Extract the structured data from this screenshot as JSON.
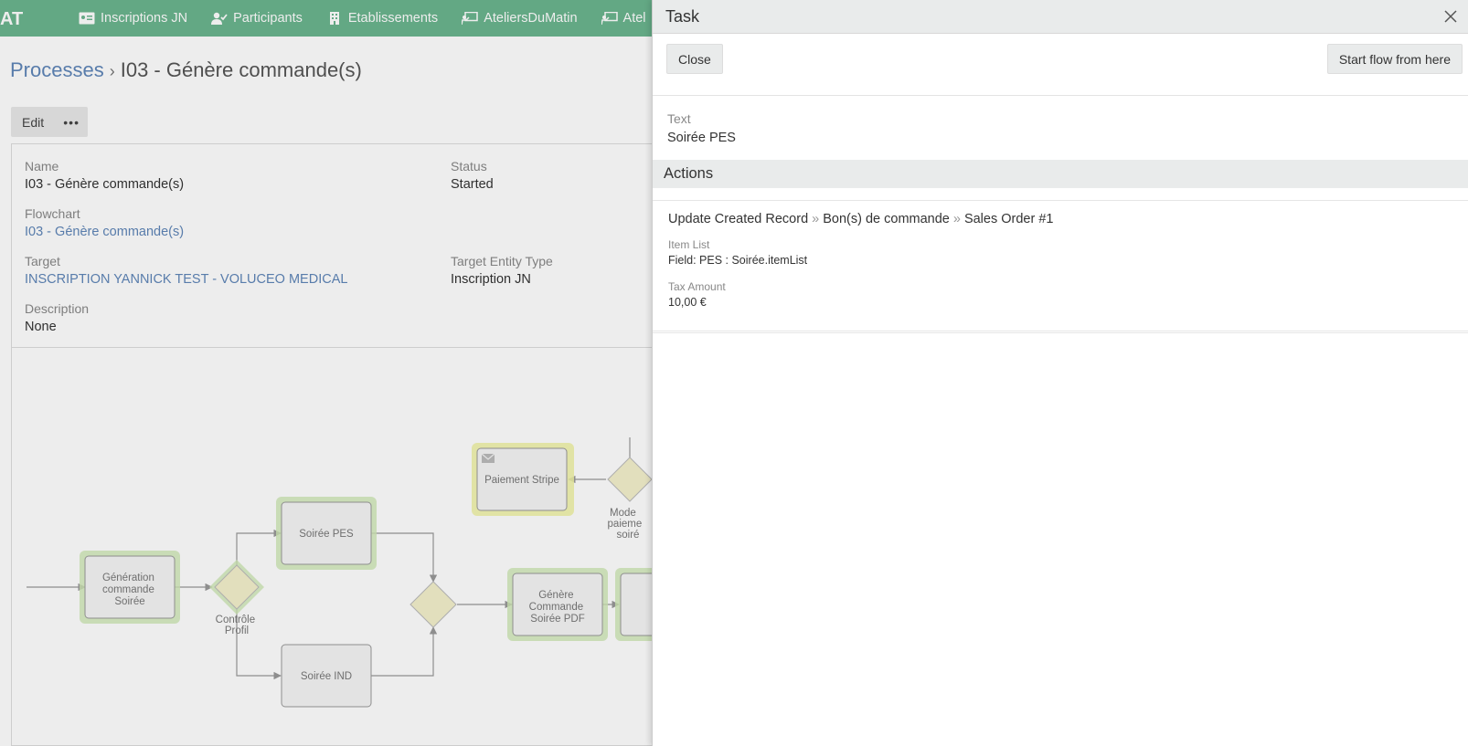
{
  "navbar": {
    "brand": "AT",
    "items": [
      {
        "label": "Inscriptions JN",
        "icon": "id-card-icon"
      },
      {
        "label": "Participants",
        "icon": "user-check-icon"
      },
      {
        "label": "Etablissements",
        "icon": "building-icon"
      },
      {
        "label": "AteliersDuMatin",
        "icon": "presentation-icon"
      },
      {
        "label": "Atel",
        "icon": "presentation-icon"
      }
    ]
  },
  "breadcrumb": {
    "parent": "Processes",
    "separator": "›",
    "current": "I03 - Génère commande(s)"
  },
  "toolbar": {
    "edit_label": "Edit",
    "more_label": "•••"
  },
  "record": {
    "name_label": "Name",
    "name_value": "I03 - Génère commande(s)",
    "status_label": "Status",
    "status_value": "Started",
    "flowchart_label": "Flowchart",
    "flowchart_value": "I03 - Génère commande(s)",
    "target_label": "Target",
    "target_value": "INSCRIPTION YANNICK TEST - VOLUCEO MEDICAL",
    "target_entity_label": "Target Entity Type",
    "target_entity_value": "Inscription JN",
    "description_label": "Description",
    "description_value": "None"
  },
  "flowchart": {
    "nodes": {
      "generation": [
        "Génération",
        "commande",
        "Soirée"
      ],
      "controle": [
        "Contrôle",
        "Profil"
      ],
      "soiree_pes": "Soirée PES",
      "soiree_ind": "Soirée IND",
      "paiement": "Paiement Stripe",
      "mode": [
        "Mode",
        "paieme",
        "soiré"
      ],
      "genere_pdf": [
        "Génère",
        "Commande",
        "Soirée PDF"
      ]
    },
    "colors": {
      "task_fill": "#f5f5f5",
      "task_stroke": "#999999",
      "gateway_fill": "#f4f0cc",
      "completed_glow": "#cfe9b5",
      "active_glow": "#f1f3a5"
    }
  },
  "side_panel": {
    "title": "Task",
    "close_label": "Close",
    "start_flow_label": "Start flow from here",
    "text_label": "Text",
    "text_value": "Soirée PES",
    "actions_header": "Actions",
    "action": {
      "title_part1": "Update Created Record",
      "title_sep": "»",
      "title_part2": "Bon(s) de commande",
      "title_part3": "Sales Order #1",
      "item_list_label": "Item List",
      "item_list_value": "Field: PES : Soirée.itemList",
      "tax_label": "Tax Amount",
      "tax_value": "10,00 €"
    }
  }
}
